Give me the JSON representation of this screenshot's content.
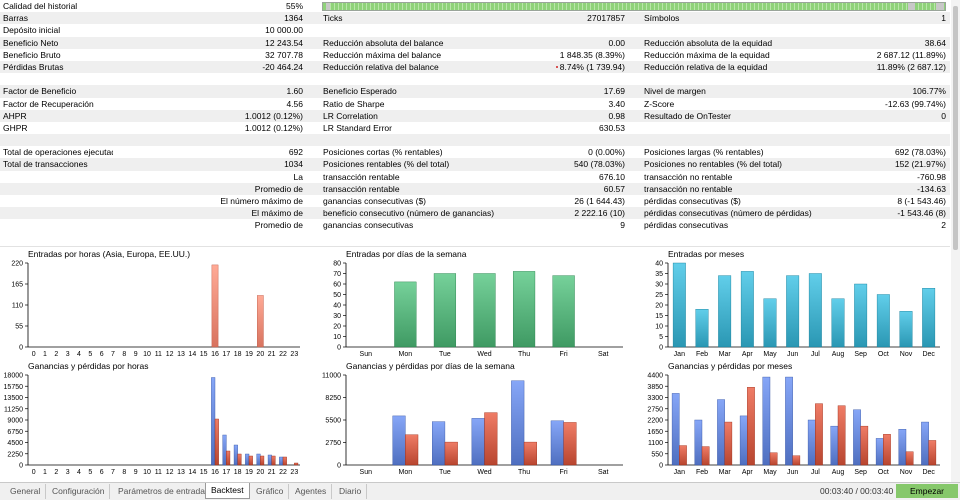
{
  "quality": {
    "label": "Calidad del historial",
    "value": "55%",
    "fill_fraction": 0.95
  },
  "report_rows": [
    {
      "cells": [
        "Barras",
        "1364",
        "Ticks",
        "27017857",
        "Símbolos",
        "1"
      ]
    },
    {
      "cells": [
        "Depósito inicial",
        "10 000.00",
        "",
        "",
        "",
        ""
      ]
    },
    {
      "cells": [
        "Beneficio Neto",
        "12 243.54",
        "Reducción absoluta del balance",
        "0.00",
        "Reducción absoluta de la equidad",
        "38.64"
      ]
    },
    {
      "cells": [
        "Beneficio Bruto",
        "32 707.78",
        "Reducción máxima del balance",
        "1 848.35 (8.39%)",
        "Reducción máxima de la equidad",
        "2 687.12 (11.89%)"
      ]
    },
    {
      "cells": [
        "Pérdidas Brutas",
        "-20 464.24",
        "Reducción relativa del balance",
        "8.74% (1 739.94)",
        "Reducción relativa de la equidad",
        "11.89% (2 687.12)"
      ],
      "dot": true
    },
    {
      "cells": [
        "",
        "",
        "",
        "",
        "",
        ""
      ]
    },
    {
      "cells": [
        "Factor de Beneficio",
        "1.60",
        "Beneficio Esperado",
        "17.69",
        "Nivel de margen",
        "106.77%"
      ]
    },
    {
      "cells": [
        "Factor de Recuperación",
        "4.56",
        "Ratio de Sharpe",
        "3.40",
        "Z-Score",
        "-12.63 (99.74%)"
      ]
    },
    {
      "cells": [
        "AHPR",
        "1.0012 (0.12%)",
        "LR Correlation",
        "0.98",
        "Resultado de OnTester",
        "0"
      ]
    },
    {
      "cells": [
        "GHPR",
        "1.0012 (0.12%)",
        "LR Standard Error",
        "630.53",
        "",
        ""
      ]
    },
    {
      "cells": [
        "",
        "",
        "",
        "",
        "",
        ""
      ]
    },
    {
      "cells": [
        "Total de operaciones ejecutadas",
        "692",
        "Posiciones cortas (% rentables)",
        "0 (0.00%)",
        "Posiciones largas (% rentables)",
        "692 (78.03%)"
      ]
    },
    {
      "cells": [
        "Total de transacciones",
        "1034",
        "Posiciones rentables (% del total)",
        "540 (78.03%)",
        "Posiciones no rentables (% del total)",
        "152 (21.97%)"
      ]
    },
    {
      "cells": [
        "La",
        "",
        "transacción rentable",
        "676.10",
        "transacción no rentable",
        "-760.98"
      ],
      "rightlabel": true
    },
    {
      "cells": [
        "Promedio de",
        "",
        "transacción rentable",
        "60.57",
        "transacción no rentable",
        "-134.63"
      ],
      "rightlabel": true
    },
    {
      "cells": [
        "El número máximo de",
        "",
        "ganancias consecutivas ($)",
        "26 (1 644.43)",
        "pérdidas consecutivas ($)",
        "8 (-1 543.46)"
      ],
      "rightlabel": true
    },
    {
      "cells": [
        "El máximo de",
        "",
        "beneficio consecutivo (número de ganancias)",
        "2 222.16 (10)",
        "pérdidas consecutivas (número de pérdidas)",
        "-1 543.46 (8)"
      ],
      "rightlabel": true
    },
    {
      "cells": [
        "Promedio de",
        "",
        "ganancias consecutivas",
        "9",
        "pérdidas consecutivas",
        "2"
      ],
      "rightlabel": true
    }
  ],
  "charts": {
    "entries_hours": {
      "title": "Entradas por horas (Asia, Europa, EE.UU.)",
      "chart_data": {
        "type": "bar",
        "categories": [
          "0",
          "1",
          "2",
          "3",
          "4",
          "5",
          "6",
          "7",
          "8",
          "9",
          "10",
          "11",
          "12",
          "13",
          "14",
          "15",
          "16",
          "17",
          "18",
          "19",
          "20",
          "21",
          "22",
          "23"
        ],
        "ylim": [
          0,
          220
        ],
        "yticks": [
          220,
          165,
          110,
          55,
          0
        ],
        "series": [
          {
            "values": [
              0,
              0,
              0,
              0,
              0,
              0,
              0,
              0,
              0,
              0,
              0,
              0,
              0,
              0,
              0,
              0,
              215,
              0,
              0,
              0,
              135,
              0,
              0,
              0
            ],
            "color": "#d8735f"
          }
        ]
      }
    },
    "entries_weekdays": {
      "title": "Entradas por días de la semana",
      "chart_data": {
        "type": "bar",
        "categories": [
          "Sun",
          "Mon",
          "Tue",
          "Wed",
          "Thu",
          "Fri",
          "Sat"
        ],
        "ylim": [
          0,
          80
        ],
        "yticks": [
          80,
          70,
          60,
          50,
          40,
          30,
          20,
          10,
          0
        ],
        "series": [
          {
            "values": [
              0,
              62,
              70,
              70,
              72,
              68,
              0
            ],
            "color": "#3f9a63"
          }
        ]
      }
    },
    "entries_months": {
      "title": "Entradas por meses",
      "chart_data": {
        "type": "bar",
        "categories": [
          "Jan",
          "Feb",
          "Mar",
          "Apr",
          "May",
          "Jun",
          "Jul",
          "Aug",
          "Sep",
          "Oct",
          "Nov",
          "Dec"
        ],
        "ylim": [
          0,
          40
        ],
        "yticks": [
          40,
          35,
          30,
          25,
          20,
          15,
          10,
          5,
          0
        ],
        "series": [
          {
            "values": [
              40,
              18,
              34,
              36,
              23,
              34,
              35,
              23,
              30,
              25,
              17,
              28
            ],
            "color": "#2a97b3"
          }
        ]
      }
    },
    "pl_hours": {
      "title": "Ganancias y pérdidas por horas",
      "chart_data": {
        "type": "bar",
        "categories": [
          "0",
          "1",
          "2",
          "3",
          "4",
          "5",
          "6",
          "7",
          "8",
          "9",
          "10",
          "11",
          "12",
          "13",
          "14",
          "15",
          "16",
          "17",
          "18",
          "19",
          "20",
          "21",
          "22",
          "23"
        ],
        "ylim": [
          0,
          18000
        ],
        "yticks": [
          18000,
          15750,
          13500,
          11250,
          9000,
          6750,
          4500,
          2250,
          0
        ],
        "series": [
          {
            "values": [
              0,
              0,
              0,
              0,
              0,
              0,
              0,
              0,
              0,
              0,
              0,
              0,
              0,
              0,
              0,
              0,
              17500,
              6000,
              4000,
              2200,
              2200,
              2000,
              1600,
              0
            ],
            "color": "#4f6fc0"
          },
          {
            "values": [
              0,
              0,
              0,
              0,
              0,
              0,
              0,
              0,
              0,
              0,
              0,
              0,
              0,
              0,
              0,
              0,
              9200,
              2800,
              2200,
              1800,
              1800,
              1800,
              1600,
              400
            ],
            "color": "#b8452f"
          }
        ]
      }
    },
    "pl_weekdays": {
      "title": "Ganancias y pérdidas por días de la semana",
      "chart_data": {
        "type": "bar",
        "categories": [
          "Sun",
          "Mon",
          "Tue",
          "Wed",
          "Thu",
          "Fri",
          "Sat"
        ],
        "ylim": [
          0,
          11000
        ],
        "yticks": [
          11000,
          8250,
          5500,
          2750,
          0
        ],
        "series": [
          {
            "values": [
              0,
              6000,
              5300,
              5700,
              10300,
              5400,
              0
            ],
            "color": "#4f6fc0"
          },
          {
            "values": [
              0,
              3700,
              2800,
              6400,
              2800,
              5200,
              0
            ],
            "color": "#b8452f"
          }
        ]
      }
    },
    "pl_months": {
      "title": "Ganancias y pérdidas por meses",
      "chart_data": {
        "type": "bar",
        "categories": [
          "Jan",
          "Feb",
          "Mar",
          "Apr",
          "May",
          "Jun",
          "Jul",
          "Aug",
          "Sep",
          "Oct",
          "Nov",
          "Dec"
        ],
        "ylim": [
          0,
          4400
        ],
        "yticks": [
          4400,
          3850,
          3300,
          2750,
          2200,
          1650,
          1100,
          550,
          0
        ],
        "series": [
          {
            "values": [
              3500,
              2200,
              3200,
              2400,
              4300,
              4300,
              2200,
              1900,
              2700,
              1300,
              1750,
              2100
            ],
            "color": "#4f6fc0"
          },
          {
            "values": [
              950,
              900,
              2100,
              3800,
              600,
              450,
              3000,
              2900,
              1900,
              1500,
              650,
              1200
            ],
            "color": "#b8452f"
          }
        ]
      }
    }
  },
  "tabs": [
    {
      "label": "General",
      "active": false
    },
    {
      "label": "Configuración",
      "active": false
    },
    {
      "label": "Parámetros de entrada",
      "active": false
    },
    {
      "label": "Backtest",
      "active": true
    },
    {
      "label": "Gráfico",
      "active": false
    },
    {
      "label": "Agentes",
      "active": false
    },
    {
      "label": "Diario",
      "active": false
    }
  ],
  "time_display": "00:03:40 / 00:03:40",
  "start_button": "Empezar"
}
